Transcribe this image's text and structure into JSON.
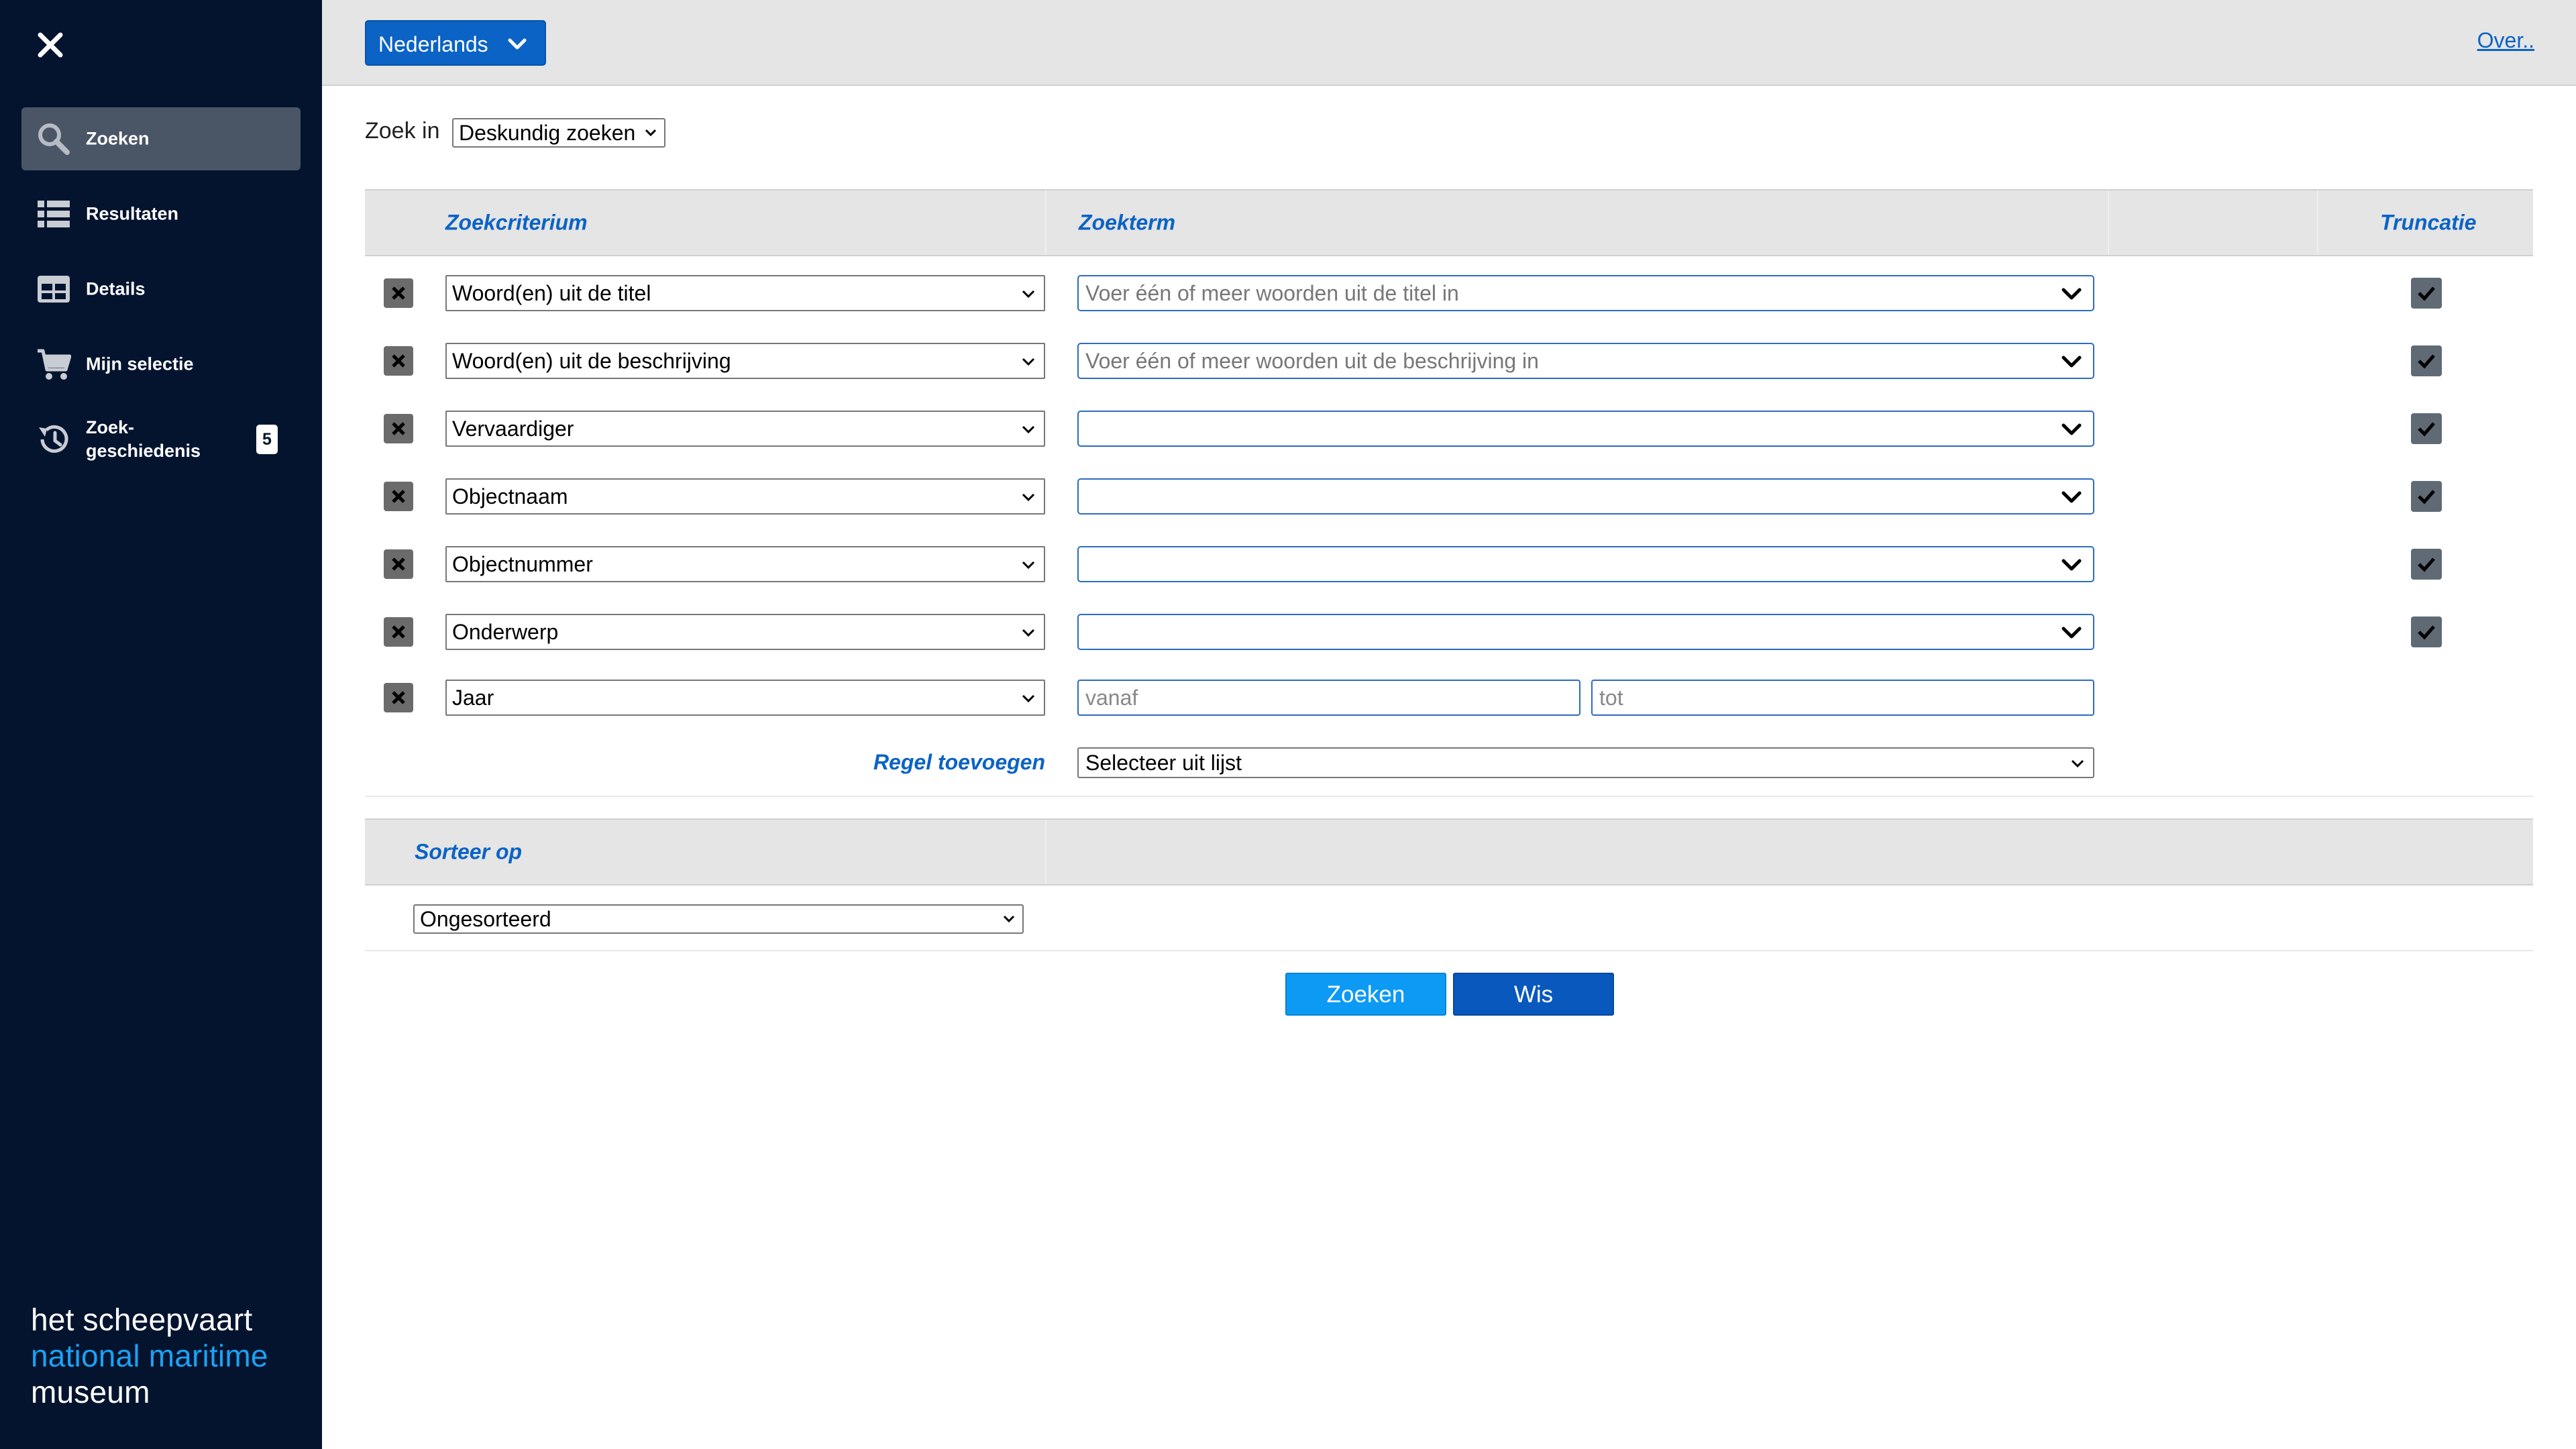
{
  "sidebar": {
    "items": [
      {
        "label": "Zoeken",
        "icon": "search-icon",
        "active": true
      },
      {
        "label": "Resultaten",
        "icon": "list-icon",
        "active": false
      },
      {
        "label": "Details",
        "icon": "details-icon",
        "active": false
      },
      {
        "label": "Mijn selectie",
        "icon": "cart-icon",
        "active": false
      },
      {
        "label": "Zoek-\ngeschiedenis",
        "icon": "history-icon",
        "active": false,
        "badge": "5"
      }
    ],
    "logo": {
      "line1": "het scheepvaart",
      "line2": "national maritime",
      "line3": "museum"
    }
  },
  "topbar": {
    "language": "Nederlands",
    "about_link": "Over.."
  },
  "search": {
    "zoek_in_label": "Zoek in",
    "zoek_in_value": "Deskundig zoeken",
    "headers": {
      "criterion": "Zoekcriterium",
      "term": "Zoekterm",
      "truncation": "Truncatie"
    },
    "rows": [
      {
        "criterion": "Woord(en) uit de titel",
        "term_placeholder": "Voer één of meer woorden uit de titel in",
        "truncation": true
      },
      {
        "criterion": "Woord(en) uit de beschrijving",
        "term_placeholder": "Voer één of meer woorden uit de beschrijving in",
        "truncation": true
      },
      {
        "criterion": "Vervaardiger",
        "term_placeholder": "",
        "truncation": true
      },
      {
        "criterion": "Objectnaam",
        "term_placeholder": "",
        "truncation": true
      },
      {
        "criterion": "Objectnummer",
        "term_placeholder": "",
        "truncation": true
      },
      {
        "criterion": "Onderwerp",
        "term_placeholder": "",
        "truncation": true
      }
    ],
    "year_row": {
      "criterion": "Jaar",
      "from_placeholder": "vanaf",
      "to_placeholder": "tot"
    },
    "add_rule_label": "Regel toevoegen",
    "add_rule_select": "Selecteer uit lijst"
  },
  "sort": {
    "header": "Sorteer op",
    "value": "Ongesorteerd"
  },
  "actions": {
    "search_label": "Zoeken",
    "clear_label": "Wis"
  },
  "colors": {
    "sidebar_bg": "#04142f",
    "accent_blue": "#0b63c5",
    "search_button": "#0c9af5",
    "clear_button": "#0858be",
    "logo_blue": "#1da1f2"
  }
}
